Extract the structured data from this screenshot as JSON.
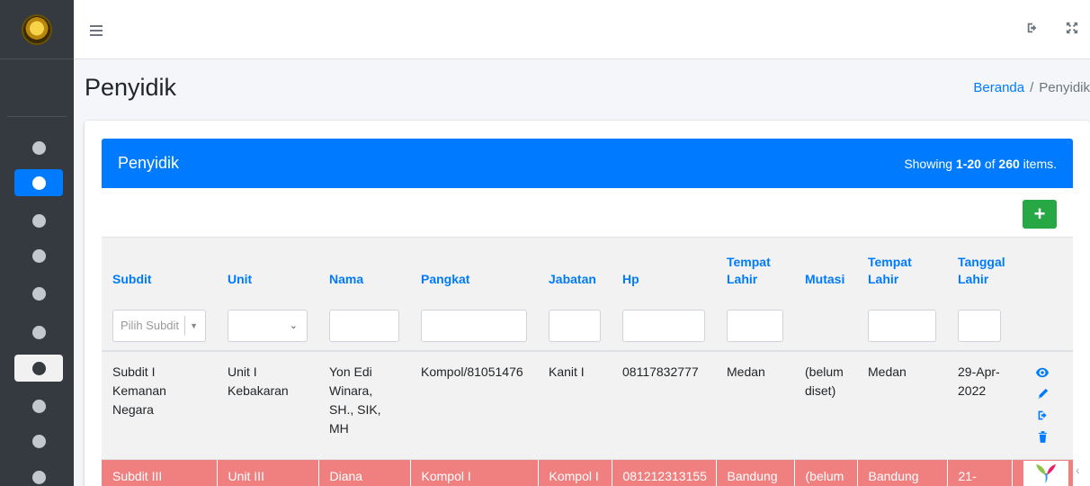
{
  "header": {
    "page_title": "Penyidik",
    "breadcrumb": {
      "home": "Beranda",
      "separator": "/",
      "current": "Penyidik"
    }
  },
  "navbar": {
    "icons": [
      "logout-icon",
      "fullscreen-icon"
    ]
  },
  "sidebar": {
    "items": [
      {
        "icon": "circle-icon",
        "active": false
      },
      {
        "icon": "circle-icon",
        "active": true
      },
      {
        "icon": "circle-icon",
        "active": false
      },
      {
        "icon": "circle-icon",
        "active": false
      },
      {
        "icon": "circle-icon",
        "active": false
      },
      {
        "icon": "circle-icon",
        "active": false
      },
      {
        "icon": "circle-icon",
        "hover": true
      },
      {
        "icon": "circle-icon",
        "active": false
      },
      {
        "icon": "circle-icon",
        "active": false
      },
      {
        "icon": "circle-icon",
        "active": false
      }
    ]
  },
  "panel": {
    "title": "Penyidik",
    "summary_prefix": "Showing ",
    "summary_range": "1-20",
    "summary_mid": " of ",
    "summary_total": "260",
    "summary_suffix": " items.",
    "add_label": "+"
  },
  "table": {
    "columns": [
      "Subdit",
      "Unit",
      "Nama",
      "Pangkat",
      "Jabatan",
      "Hp",
      "Tempat Lahir",
      "Mutasi",
      "Tempat Lahir",
      "Tanggal Lahir"
    ],
    "filters": {
      "subdit_placeholder": "Pilih Subdit"
    },
    "rows": [
      {
        "subdit": "Subdit I Kemanan Negara",
        "unit": "Unit I Kebakaran",
        "nama": "Yon Edi Winara, SH., SIK, MH",
        "pangkat": "Kompol/81051476",
        "jabatan": "Kanit I",
        "hp": "08117832777",
        "tempat_lahir": "Medan",
        "mutasi": "(belum diset)",
        "tempat_lahir2": "Medan",
        "tanggal_lahir": "29-Apr-2022"
      },
      {
        "subdit": "Subdit III",
        "unit": "Unit III",
        "nama": "Diana",
        "pangkat": "Kompol I",
        "jabatan": "Kompol I",
        "hp": "081212313155",
        "tempat_lahir": "Bandung",
        "mutasi": "(belum",
        "tempat_lahir2": "Bandung",
        "tanggal_lahir": "21-"
      }
    ]
  },
  "colors": {
    "primary": "#007bff",
    "success": "#28a745",
    "sidebar": "#343a40",
    "row_highlight": "#f08080"
  }
}
